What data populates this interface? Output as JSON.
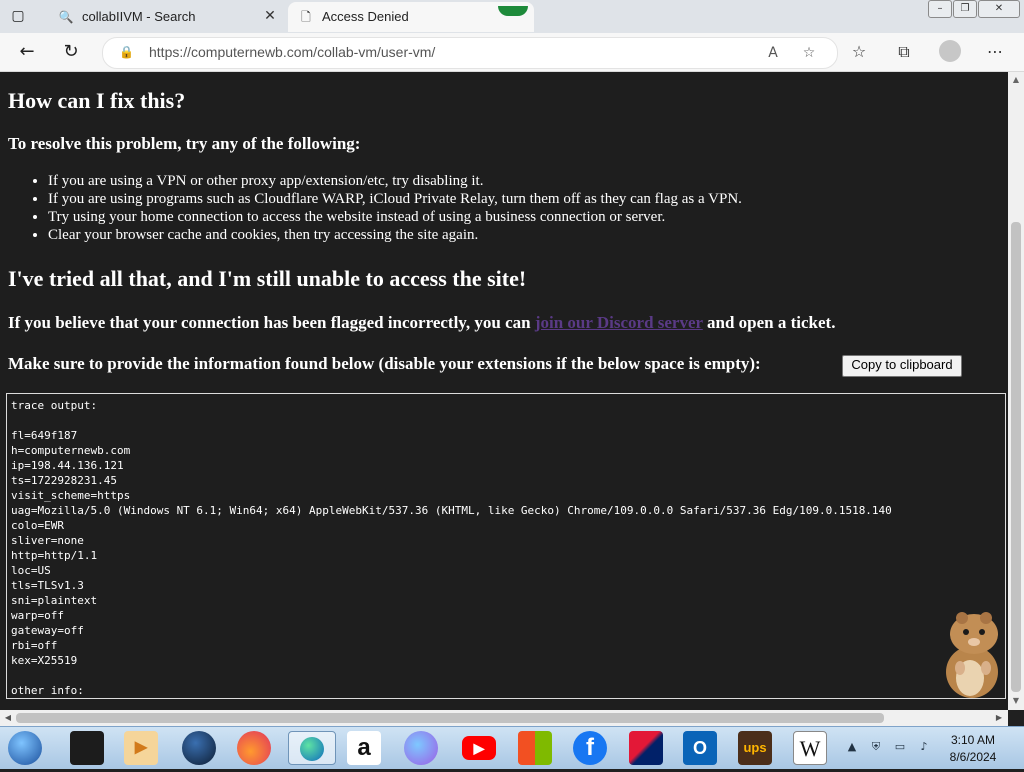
{
  "browser": {
    "tabs": [
      {
        "title": "collabIIVM - Search",
        "icon": "search-icon",
        "active": false
      },
      {
        "title": "Access Denied",
        "icon": "page-icon",
        "active": true
      }
    ],
    "url": "https://computernewb.com/collab-vm/user-vm/",
    "accent_color": "#1d8a3a"
  },
  "page": {
    "heading_fix": "How can I fix this?",
    "subheading_resolve": "To resolve this problem, try any of the following:",
    "tips": [
      "If you are using a VPN or other proxy app/extension/etc, try disabling it.",
      "If you are using programs such as Cloudflare WARP, iCloud Private Relay, turn them off as they can flag as a VPN.",
      "Try using your home connection to access the website instead of using a business connection or server.",
      "Clear your browser cache and cookies, then try accessing the site again."
    ],
    "heading_tried": "I've tried all that, and I'm still unable to access the site!",
    "flagged_text_before": "If you believe that your connection has been flagged incorrectly, you can",
    "discord_link": "join our Discord server",
    "flagged_text_after": "and open a ticket.",
    "provide_info": "Make sure to provide the information found below (disable your extensions if the below space is empty):",
    "copy_button": "Copy to clipboard",
    "trace_output": "trace output:\n\nfl=649f187\nh=computernewb.com\nip=198.44.136.121\nts=1722928231.45\nvisit_scheme=https\nuag=Mozilla/5.0 (Windows NT 6.1; Win64; x64) AppleWebKit/537.36 (KHTML, like Gecko) Chrome/109.0.0.0 Safari/537.36 Edg/109.0.1518.140\ncolo=EWR\nsliver=none\nhttp=http/1.1\nloc=US\ntls=TLSv1.3\nsni=plaintext\nwarp=off\ngateway=off\nrbi=off\nkex=X25519\n\nother info:"
  },
  "taskbar": {
    "items": [
      {
        "name": "start-orb"
      },
      {
        "name": "terminal-app"
      },
      {
        "name": "media-player-app"
      },
      {
        "name": "globe-app"
      },
      {
        "name": "firefox-app"
      },
      {
        "name": "edge-app",
        "active": true
      },
      {
        "name": "amazon-app",
        "label": "a"
      },
      {
        "name": "copilot-app"
      },
      {
        "name": "youtube-app"
      },
      {
        "name": "store-app"
      },
      {
        "name": "facebook-app",
        "label": "f"
      },
      {
        "name": "bank-app"
      },
      {
        "name": "outlook-app",
        "label": "O"
      },
      {
        "name": "ups-app",
        "label": "ups"
      },
      {
        "name": "wikipedia-app",
        "label": "W"
      }
    ],
    "time": "3:10 AM",
    "date": "8/6/2024"
  }
}
